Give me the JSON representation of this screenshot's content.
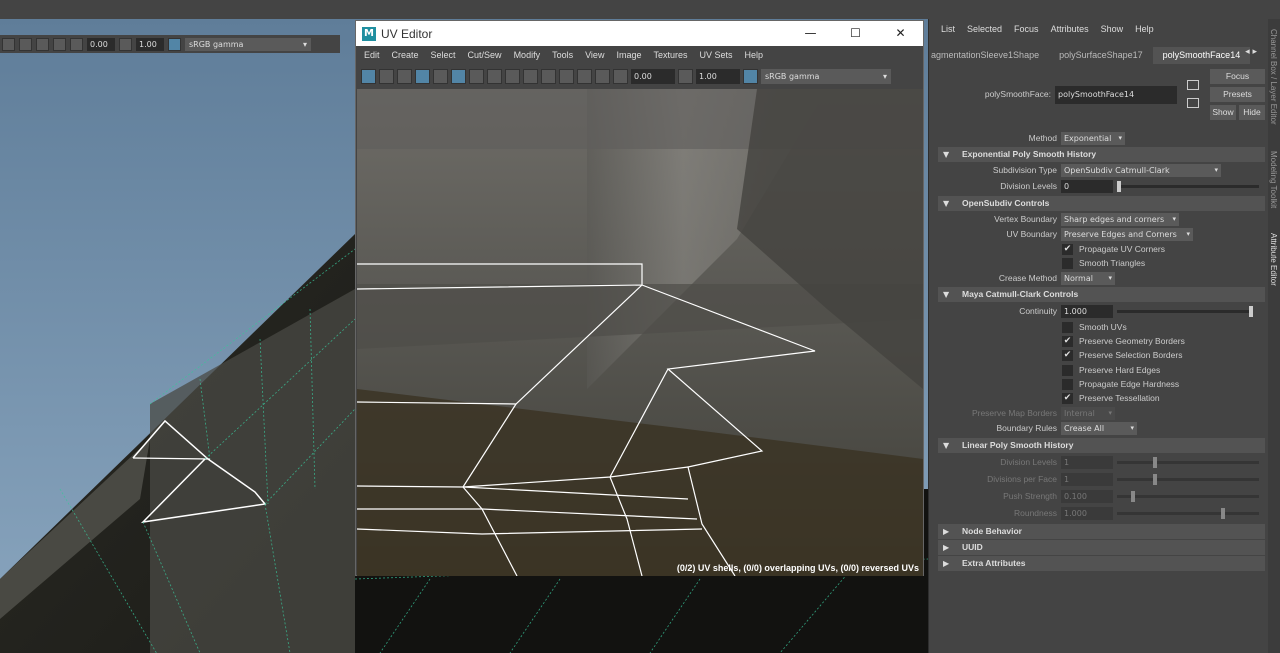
{
  "viewport": {
    "toolbar": {
      "exposure": "0.00",
      "gamma": "1.00",
      "color_space": "sRGB gamma"
    }
  },
  "uv_editor": {
    "title": "UV Editor",
    "window_buttons": {
      "minimize": "—",
      "maximize": "☐",
      "close": "✕"
    },
    "menu": [
      "Edit",
      "Create",
      "Select",
      "Cut/Sew",
      "Modify",
      "Tools",
      "View",
      "Image",
      "Textures",
      "UV Sets",
      "Help"
    ],
    "toolbar": {
      "exposure": "0.00",
      "gamma": "1.00",
      "color_space": "sRGB gamma"
    },
    "status": "(0/2) UV shells, (0/0) overlapping UVs, (0/0) reversed UVs"
  },
  "attribute_editor": {
    "menu": [
      "List",
      "Selected",
      "Focus",
      "Attributes",
      "Show",
      "Help"
    ],
    "tabs": [
      "agmentationSleeve1Shape",
      "polySurfaceShape17",
      "polySmoothFace14"
    ],
    "active_tab": "polySmoothFace14",
    "node_label": "polySmoothFace:",
    "node_name": "polySmoothFace14",
    "buttons": {
      "focus": "Focus",
      "presets": "Presets",
      "show": "Show",
      "hide": "Hide"
    },
    "method_label": "Method",
    "method_value": "Exponential",
    "sections": {
      "exponential": "Exponential Poly Smooth History",
      "opensubdiv": "OpenSubdiv Controls",
      "catmull": "Maya Catmull-Clark Controls",
      "linear": "Linear Poly Smooth History",
      "node_behavior": "Node Behavior",
      "uuid": "UUID",
      "extra": "Extra Attributes"
    },
    "subdivision_type": {
      "label": "Subdivision Type",
      "value": "OpenSubdiv Catmull-Clark"
    },
    "division_levels": {
      "label": "Division Levels",
      "value": "0",
      "slider": 0.0
    },
    "vertex_boundary": {
      "label": "Vertex Boundary",
      "value": "Sharp edges and corners"
    },
    "uv_boundary": {
      "label": "UV Boundary",
      "value": "Preserve Edges and Corners"
    },
    "propagate_uv_corners": {
      "label": "Propagate UV Corners",
      "checked": true
    },
    "smooth_triangles": {
      "label": "Smooth Triangles",
      "checked": false
    },
    "crease_method": {
      "label": "Crease Method",
      "value": "Normal"
    },
    "continuity": {
      "label": "Continuity",
      "value": "1.000",
      "slider": 1.0
    },
    "smooth_uvs": {
      "label": "Smooth UVs",
      "checked": false
    },
    "preserve_geometry_borders": {
      "label": "Preserve Geometry Borders",
      "checked": true
    },
    "preserve_selection_borders": {
      "label": "Preserve Selection Borders",
      "checked": true
    },
    "preserve_hard_edges": {
      "label": "Preserve Hard Edges",
      "checked": false
    },
    "propagate_edge_hardness": {
      "label": "Propagate Edge Hardness",
      "checked": false
    },
    "preserve_tessellation": {
      "label": "Preserve Tessellation",
      "checked": true
    },
    "preserve_map_borders": {
      "label": "Preserve Map Borders",
      "value": "Internal"
    },
    "boundary_rules": {
      "label": "Boundary Rules",
      "value": "Crease All"
    },
    "linear_division_levels": {
      "label": "Division Levels",
      "value": "1"
    },
    "divisions_per_face": {
      "label": "Divisions per Face",
      "value": "1"
    },
    "push_strength": {
      "label": "Push Strength",
      "value": "0.100"
    },
    "roundness": {
      "label": "Roundness",
      "value": "1.000"
    }
  },
  "side_tabs": [
    "Channel Box / Layer Editor",
    "Modeling Toolkit",
    "Attribute Editor"
  ]
}
